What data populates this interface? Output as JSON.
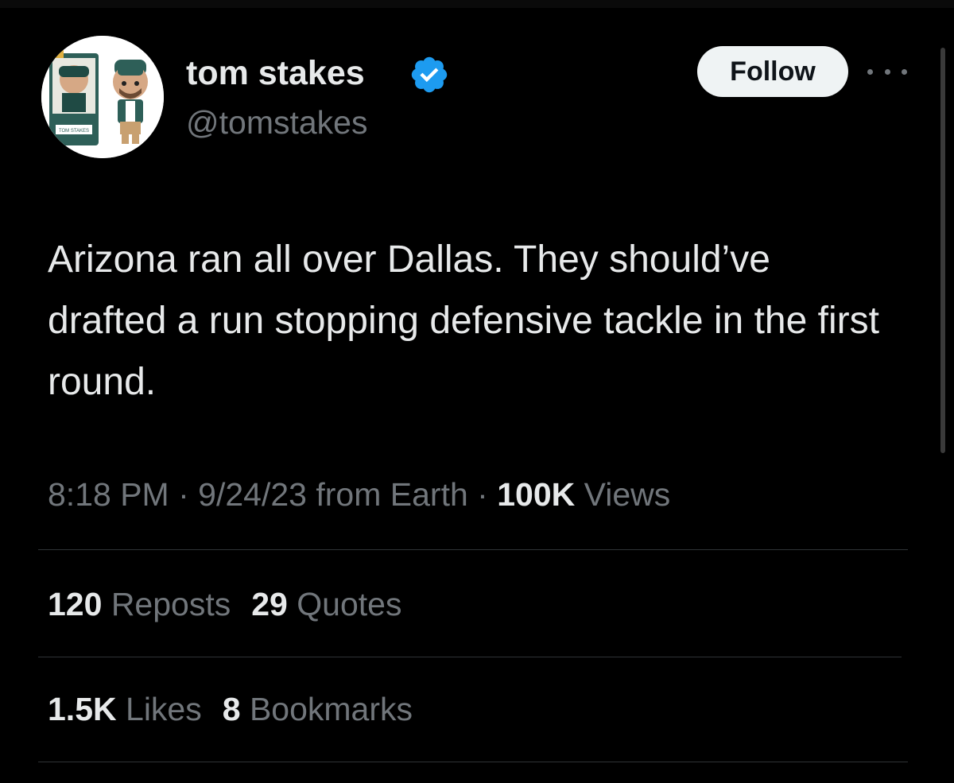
{
  "author": {
    "display_name": "tom stakes",
    "handle": "@tomstakes",
    "verified": true,
    "avatar_icon": "funko-pop-avatar",
    "avatar_box_text": "TOM STAKES"
  },
  "actions": {
    "follow_label": "Follow",
    "more_icon": "more-dots-icon"
  },
  "tweet": {
    "text": "Arizona ran all over Dallas. They should’ve drafted a run stopping defensive tackle in the first round.",
    "time": "8:18 PM",
    "separator": "·",
    "date": "9/24/23",
    "source": "from Earth",
    "views_count": "100K",
    "views_label": "Views"
  },
  "stats": {
    "reposts_count": "120",
    "reposts_label": "Reposts",
    "quotes_count": "29",
    "quotes_label": "Quotes",
    "likes_count": "1.5K",
    "likes_label": "Likes",
    "bookmarks_count": "8",
    "bookmarks_label": "Bookmarks"
  },
  "colors": {
    "background": "#000000",
    "primary_text": "#e7e9ea",
    "secondary_text": "#71767b",
    "verified_blue": "#1d9bf0",
    "divider": "#2f3336",
    "follow_bg": "#eff3f4"
  }
}
